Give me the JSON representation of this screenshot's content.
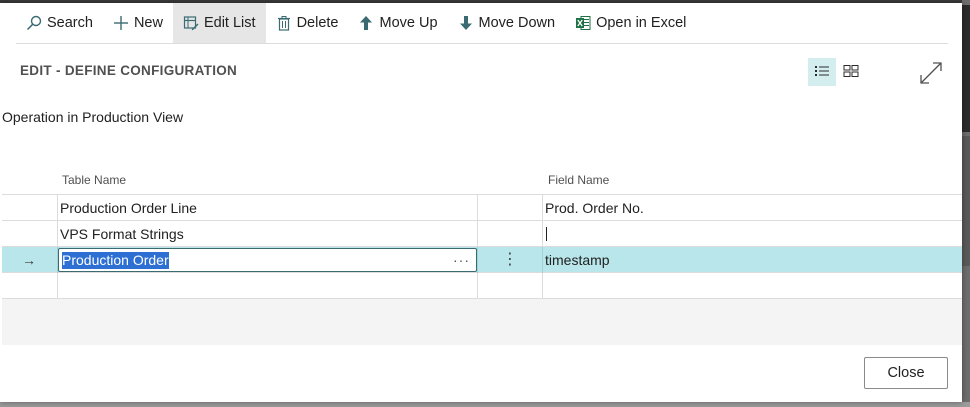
{
  "actionbar": {
    "items": [
      {
        "label": "Search",
        "icon": "search-icon"
      },
      {
        "label": "New",
        "icon": "plus-icon"
      },
      {
        "label": "Edit List",
        "icon": "edit-list-icon",
        "active": true
      },
      {
        "label": "Delete",
        "icon": "trash-icon"
      },
      {
        "label": "Move Up",
        "icon": "arrow-up-icon"
      },
      {
        "label": "Move Down",
        "icon": "arrow-down-icon"
      },
      {
        "label": "Open in Excel",
        "icon": "excel-icon"
      }
    ]
  },
  "page": {
    "caption": "EDIT - DEFINE CONFIGURATION",
    "subtitle": "Operation in Production View"
  },
  "grid": {
    "columns": [
      "Table Name",
      "Field Name"
    ],
    "rows": [
      {
        "table_name": "Production Order Line",
        "field_name": "Prod. Order No."
      },
      {
        "table_name": "VPS Format Strings",
        "field_name": ""
      },
      {
        "table_name": "Production Order",
        "field_name": "timestamp",
        "selected": true
      },
      {
        "table_name": "",
        "field_name": ""
      }
    ],
    "row_marker": "→",
    "lookup_dots": "···",
    "row_menu": "⋮"
  },
  "footer": {
    "close_label": "Close"
  },
  "colors": {
    "selected_row": "#b8e6ea",
    "text_selection": "#2e6fd4",
    "active_view": "#d4eef0"
  }
}
